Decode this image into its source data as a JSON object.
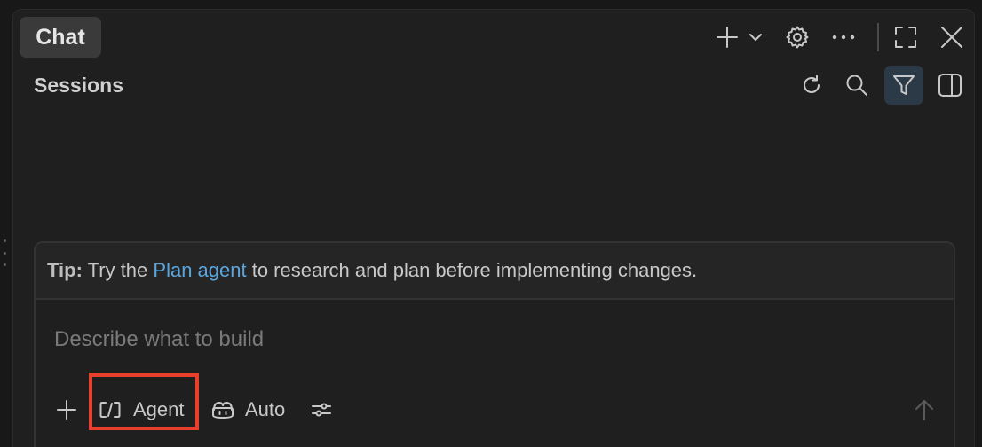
{
  "header": {
    "tab_label": "Chat",
    "icons": [
      "plus-icon",
      "chevron-down-icon",
      "gear-icon",
      "more-icon",
      "maximize-icon",
      "close-icon"
    ]
  },
  "sessions": {
    "title": "Sessions",
    "icons": [
      "refresh-icon",
      "search-icon",
      "filter-icon",
      "split-view-icon"
    ]
  },
  "tip": {
    "label": "Tip:",
    "prefix": " Try the ",
    "link_text": "Plan agent",
    "suffix": " to research and plan before implementing changes."
  },
  "input": {
    "placeholder": "Describe what to build"
  },
  "toolbar": {
    "mode_label": "Agent",
    "model_label": "Auto",
    "icons": [
      "add-icon",
      "agent-icon",
      "copilot-icon",
      "settings-sliders-icon",
      "send-arrow-icon"
    ]
  },
  "colors": {
    "background": "#1f1f1f",
    "accent_link": "#5aa7e0",
    "highlight": "#e8402a",
    "active_filter": "#2c3a47"
  }
}
